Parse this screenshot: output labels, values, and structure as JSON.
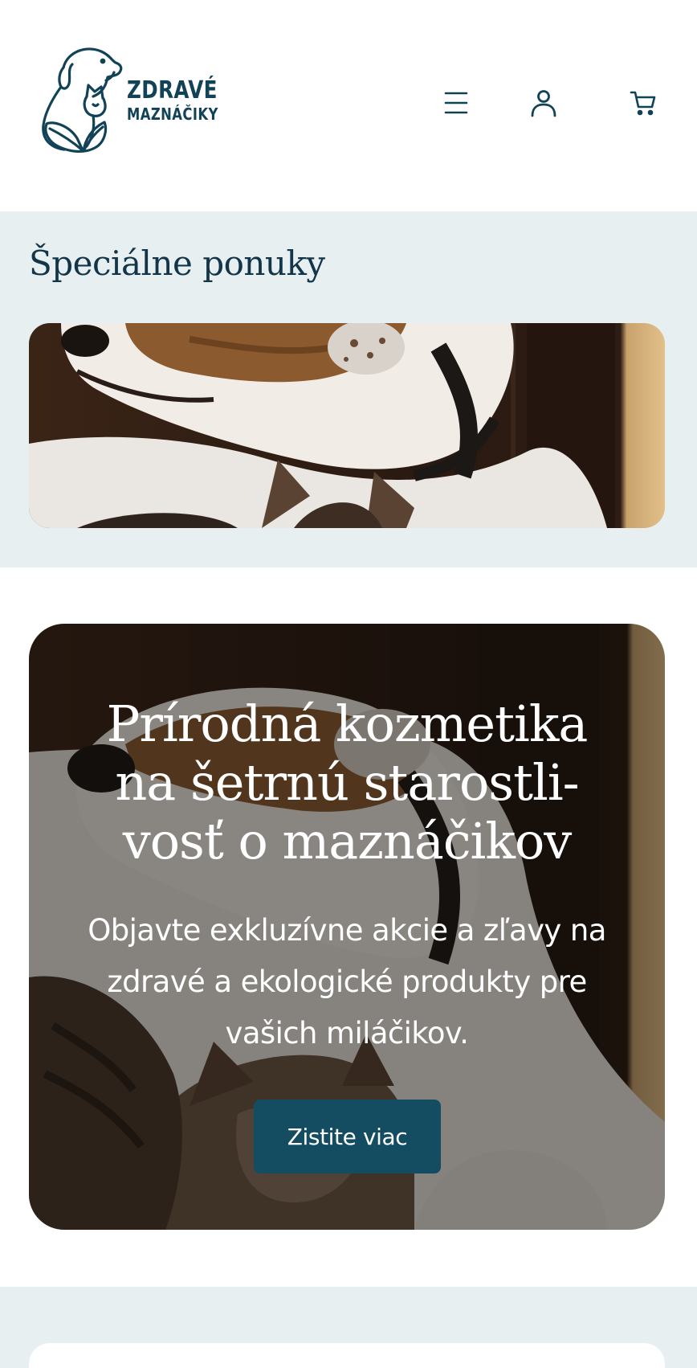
{
  "brand": {
    "line1": "ZDRAVÉ",
    "line2": "MAZNÁČIKY",
    "logo_icon": "dog-cat-leaf-logo",
    "color": "#124257"
  },
  "header": {
    "menu_icon": "hamburger-menu-icon",
    "account_icon": "user-account-icon",
    "cart_icon": "shopping-cart-icon"
  },
  "offers": {
    "title": "Špeciálne ponuky",
    "banner_image": "dog-and-cat-photo"
  },
  "hero": {
    "title": "Prírodná kozmetika na šetrnú starostli-vosť o maznáčikov",
    "text": "Objavte exkluzívne akcie a zľavy na zdravé a ekologické produkty pre vašich miláčikov.",
    "cta_label": "Zistite viac",
    "cta_color": "#144d62",
    "image": "dog-and-kitten-photo"
  },
  "colors": {
    "section_bg": "#e8eff1",
    "heading": "#12354a"
  }
}
